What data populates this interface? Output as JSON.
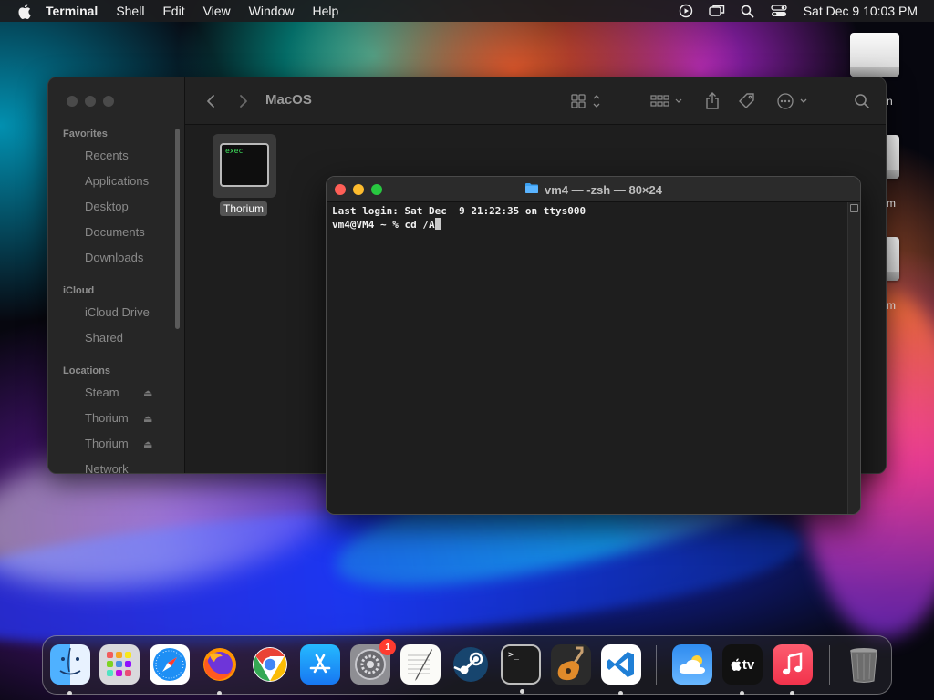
{
  "menubar": {
    "app_name": "Terminal",
    "items": [
      "Shell",
      "Edit",
      "View",
      "Window",
      "Help"
    ],
    "clock": "Sat Dec 9  10:03 PM"
  },
  "desktop": {
    "drive_labels": [
      "n",
      "m",
      "m"
    ]
  },
  "finder": {
    "title": "MacOS",
    "sidebar": {
      "favorites_header": "Favorites",
      "favorites": [
        "Recents",
        "Applications",
        "Desktop",
        "Documents",
        "Downloads"
      ],
      "icloud_header": "iCloud",
      "icloud": [
        "iCloud Drive",
        "Shared"
      ],
      "locations_header": "Locations",
      "locations": [
        "Steam",
        "Thorium",
        "Thorium",
        "Network"
      ]
    },
    "file": {
      "icon_text": "exec",
      "name": "Thorium"
    }
  },
  "terminal": {
    "title": "vm4 — -zsh — 80×24",
    "line1": "Last login: Sat Dec  9 21:22:35 on ttys000",
    "prompt": "vm4@VM4 ~ % cd /A"
  },
  "dock": {
    "apps": [
      "Finder",
      "Launchpad",
      "Safari",
      "Firefox",
      "Chrome",
      "App Store",
      "System Preferences",
      "TextEdit",
      "Steam",
      "Terminal",
      "GarageBand",
      "Visual Studio Code",
      "Weather",
      "Apple TV",
      "Music",
      "Trash"
    ],
    "system_prefs_badge": "1",
    "tv_label": "tv"
  },
  "colors": {
    "close": "#ff5f57",
    "minimize": "#febc2e",
    "maximize": "#28c840",
    "exec_green": "#3fe05c"
  }
}
